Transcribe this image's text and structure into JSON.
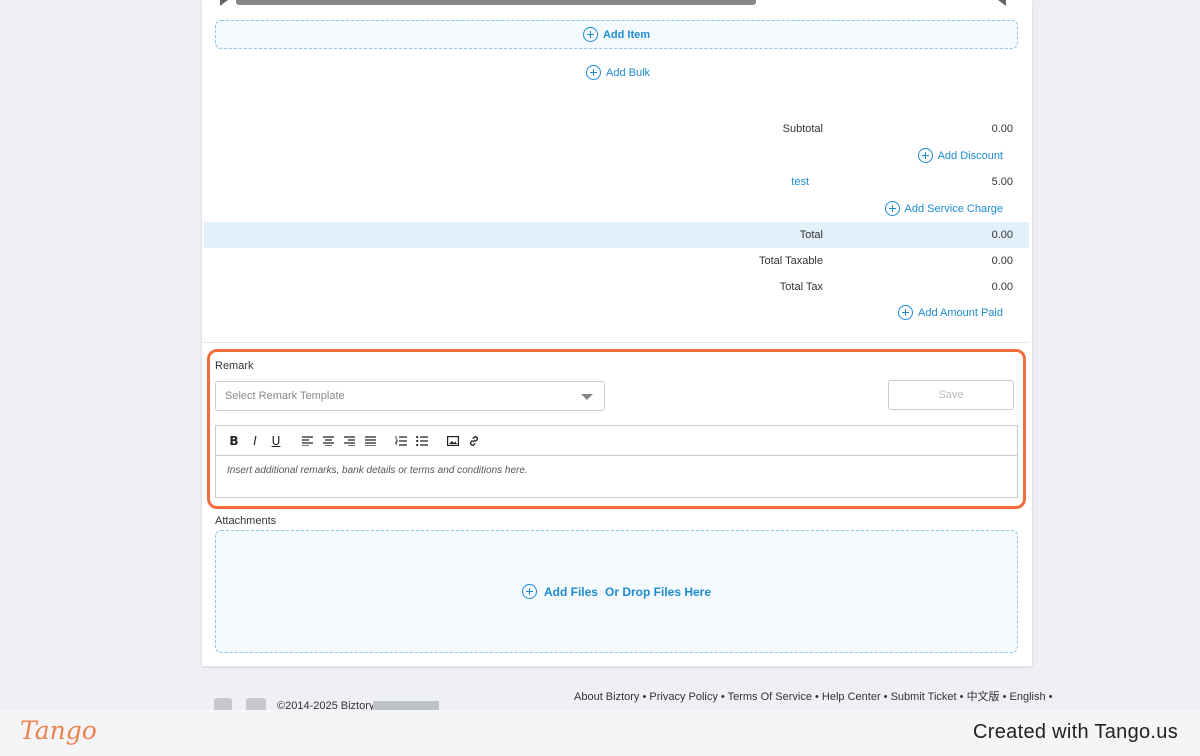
{
  "actions": {
    "add_item": "Add Item",
    "add_bulk": "Add Bulk"
  },
  "summary": {
    "subtotal_label": "Subtotal",
    "subtotal_value": "0.00",
    "add_discount": "Add Discount",
    "charge_label": "test",
    "charge_value": "5.00",
    "add_service_charge": "Add Service Charge",
    "total_label": "Total",
    "total_value": "0.00",
    "total_taxable_label": "Total Taxable",
    "total_taxable_value": "0.00",
    "total_tax_label": "Total Tax",
    "total_tax_value": "0.00",
    "add_amount_paid": "Add Amount Paid"
  },
  "remark": {
    "title": "Remark",
    "template_placeholder": "Select Remark Template",
    "save_label": "Save",
    "editor_placeholder": "Insert additional remarks, bank details or terms and conditions here.",
    "toolbar": [
      "B",
      "I",
      "U"
    ]
  },
  "attachments": {
    "title": "Attachments",
    "add_files": "Add Files",
    "drop_text": "Or Drop Files Here"
  },
  "footer": {
    "copyright": "©2014-2025 Biztory",
    "links": "About Biztory • Privacy Policy • Terms Of Service • Help Center • Submit Ticket • 中文版 • English •"
  },
  "branding": {
    "logo": "Tango",
    "created_with": "Created with Tango.us"
  },
  "colors": {
    "accent": "#1d8bd1",
    "highlight_outline": "#f26d3d",
    "total_row_bg": "#e2f1f9"
  }
}
